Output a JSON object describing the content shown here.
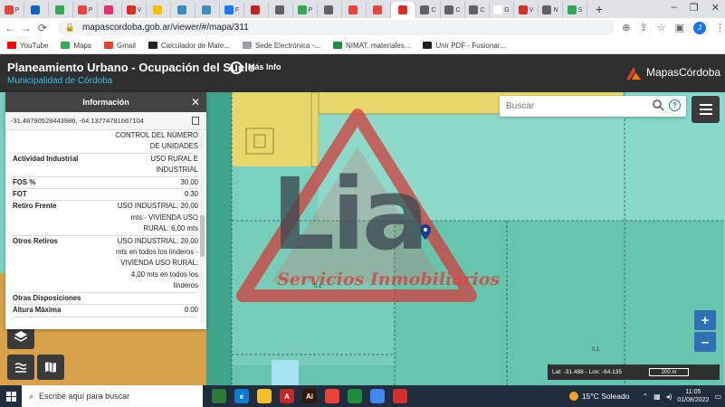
{
  "browser": {
    "tabs": [
      {
        "label": "P",
        "color": "#e8453c"
      },
      {
        "label": "",
        "color": "#0a66c2"
      },
      {
        "label": "",
        "color": "#34a853"
      },
      {
        "label": "P",
        "color": "#e8453c"
      },
      {
        "label": "",
        "color": "#e1306c"
      },
      {
        "label": "V",
        "color": "#d93025"
      },
      {
        "label": "",
        "color": "#fbbc04"
      },
      {
        "label": "",
        "color": "#3c8dbc"
      },
      {
        "label": "",
        "color": "#3c8dbc"
      },
      {
        "label": "F",
        "color": "#1877f2"
      },
      {
        "label": "",
        "color": "#c5221f"
      },
      {
        "label": "",
        "color": "#5f6368"
      },
      {
        "label": "P",
        "color": "#34a853"
      },
      {
        "label": "",
        "color": "#5f6368"
      },
      {
        "label": "",
        "color": "#e8453c"
      },
      {
        "label": "",
        "color": "#e8453c"
      },
      {
        "label": "",
        "color": "#d93025"
      },
      {
        "label": "C",
        "color": "#5f6368"
      },
      {
        "label": "C",
        "color": "#5f6368"
      },
      {
        "label": "C",
        "color": "#5f6368"
      },
      {
        "label": "G",
        "color": "#ffffff"
      },
      {
        "label": "V",
        "color": "#d93025"
      },
      {
        "label": "N",
        "color": "#5f6368"
      },
      {
        "label": "S",
        "color": "#34a853"
      }
    ],
    "active_tab_index": 16,
    "new_tab": "+",
    "window_controls": [
      "–",
      "❐",
      "✕"
    ],
    "url": "mapascordoba.gob.ar/viewer/#/mapa/311",
    "profile_initial": "J",
    "bookmarks": [
      {
        "label": "YouTube",
        "color": "#ff0000"
      },
      {
        "label": "Maps",
        "color": "#34a853"
      },
      {
        "label": "Gmail",
        "color": "#ea4335"
      },
      {
        "label": "Calculador de Mate...",
        "color": "#222222"
      },
      {
        "label": "Sede Electrónica -...",
        "color": "#9aa0a6"
      },
      {
        "label": "NIMAT, materiales...",
        "color": "#1e8e3e"
      },
      {
        "label": "Unir PDF - Fusionar...",
        "color": "#202124"
      }
    ]
  },
  "app": {
    "title": "Planeamiento Urbano - Ocupación del Suelo",
    "subtitle": "Municipalidad de Córdoba",
    "more_info_label": "Más Info",
    "brand_name": "MapasCórdoba",
    "search_placeholder": "Buscar",
    "zoom_in": "+",
    "zoom_out": "–",
    "scale": {
      "lat_lon": "Lat: -31.488 - Lon: -64.135",
      "distance": "200 m"
    },
    "map_marker_label": "0.1",
    "map_marker_label_2": "0.1"
  },
  "info_panel": {
    "title": "Información",
    "coordinates": "-31.48790528443986, -64.13774781667104",
    "rows": [
      {
        "key": "",
        "value": "CONTROL DEL NÚMERO DE UNIDADES"
      },
      {
        "key": "Actividad Industrial",
        "value": "USO RURAL E INDUSTRIAL"
      },
      {
        "key": "FOS %",
        "value": "30.00"
      },
      {
        "key": "FOT",
        "value": "0.30"
      },
      {
        "key": "Retiro Frente",
        "value": "USO INDUSTRIAL: 20,00 mts - VIVIENDA USO RURAL: 6,00 mts"
      },
      {
        "key": "Otros Retiros",
        "value": "USO INDUSTRIAL: 20,00 mts en todos los linderos - VIVIENDA USO RURAL: 4,00 mts en todos los linderos"
      },
      {
        "key": "Otras Disposiciones",
        "value": ""
      },
      {
        "key": "Altura Máxima",
        "value": "0.00"
      }
    ]
  },
  "watermark": {
    "letters": "Lia",
    "tagline": "Servicios Inmobiliarios"
  },
  "taskbar": {
    "search_placeholder": "Escribe aquí para buscar",
    "weather": "15°C  Soleado",
    "time": "11:05",
    "date": "01/08/2022",
    "apps": [
      {
        "label": "",
        "color": "#2b7a3b"
      },
      {
        "label": "e",
        "color": "#0c7bd6"
      },
      {
        "label": "",
        "color": "#f3c12c"
      },
      {
        "label": "A",
        "color": "#c62828"
      },
      {
        "label": "Ai",
        "color": "#331700"
      },
      {
        "label": "",
        "color": "#ea4335"
      },
      {
        "label": "",
        "color": "#1e8e3e"
      },
      {
        "label": "",
        "color": "#4285f4"
      },
      {
        "label": "",
        "color": "#d32f2f"
      }
    ]
  }
}
